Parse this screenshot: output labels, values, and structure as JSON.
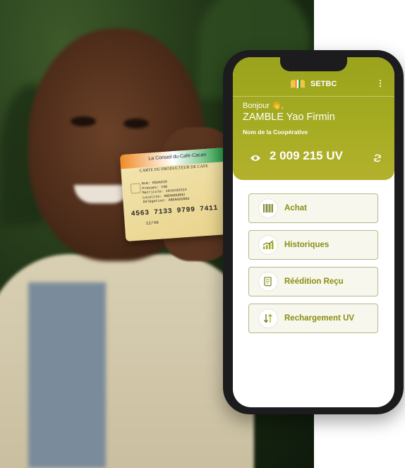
{
  "photo": {
    "card": {
      "banner": "La Conseil du Café-Cacao",
      "title": "CARTE DU PRODUCTEUR DE CAFE",
      "fields": [
        "Nom: KOUADIO",
        "Prénoms: YAO",
        "Matricule: 1010102524",
        "Localité: ABENGOUROU",
        "Délégation: ABENGOUROU"
      ],
      "number": "4563 7133 9799 7411",
      "expiry": "12/49"
    }
  },
  "app": {
    "brand": "SETBC",
    "menu_icon": "more-vertical-icon",
    "greeting": "Bonjour 👋,",
    "user_name": "ZAMBLE Yao Firmin",
    "coop_name": "Nom de la Coopérative",
    "balance": "2 009 215 UV",
    "accent_color": "#a5ac22",
    "menu_items": [
      {
        "label": "Achat",
        "icon": "barcode-icon"
      },
      {
        "label": "Historiques",
        "icon": "chart-icon"
      },
      {
        "label": "Réédition Reçu",
        "icon": "receipt-icon"
      },
      {
        "label": "Rechargement UV",
        "icon": "transfer-icon"
      }
    ]
  }
}
